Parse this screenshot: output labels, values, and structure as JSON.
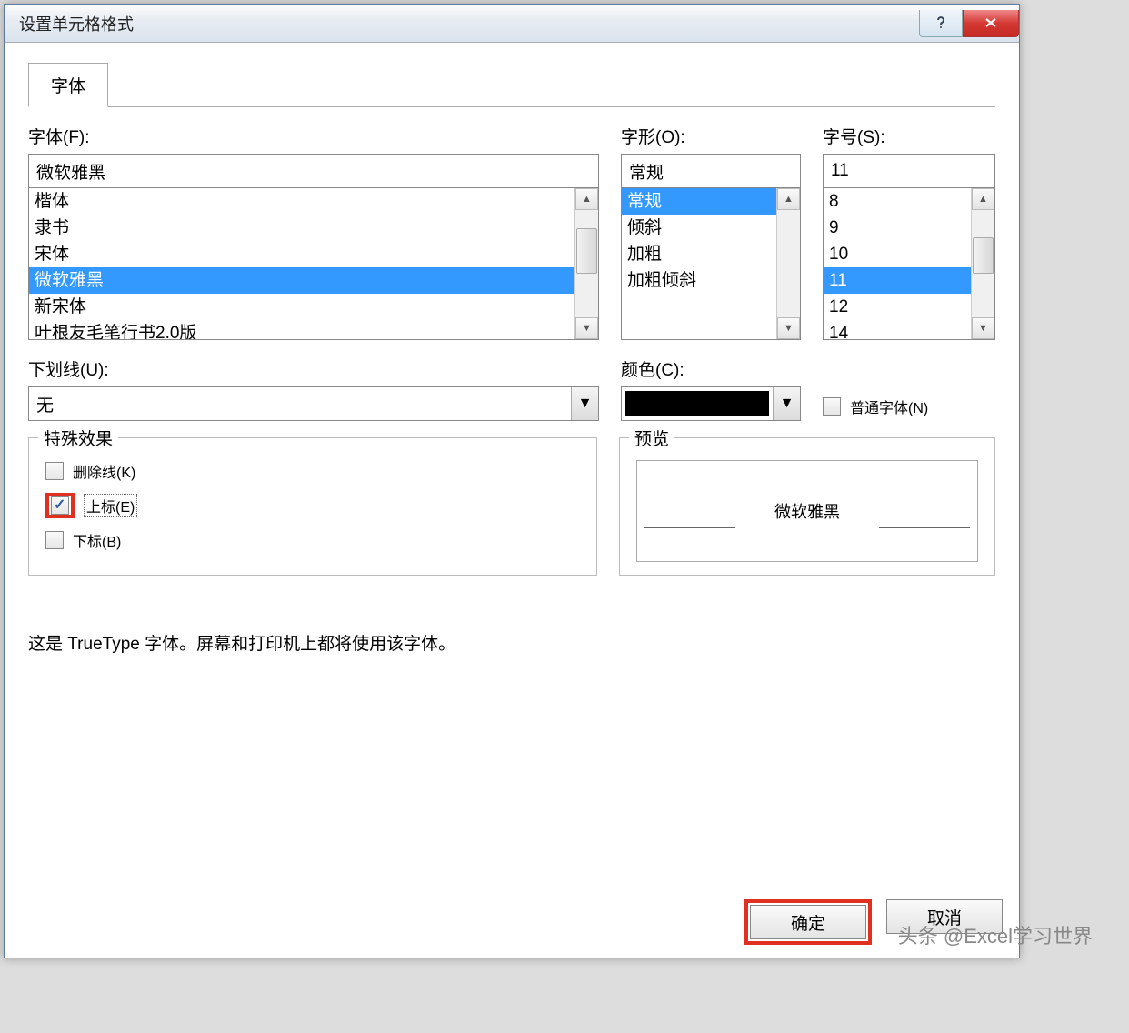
{
  "dialog": {
    "title": "设置单元格格式",
    "tab": "字体"
  },
  "font": {
    "label": "字体(F):",
    "value": "微软雅黑",
    "items": [
      "楷体",
      "隶书",
      "宋体",
      "微软雅黑",
      "新宋体",
      "叶根友毛笔行书2.0版"
    ],
    "selected_index": 3
  },
  "style": {
    "label": "字形(O):",
    "value": "常规",
    "items": [
      "常规",
      "倾斜",
      "加粗",
      "加粗倾斜"
    ],
    "selected_index": 0
  },
  "size": {
    "label": "字号(S):",
    "value": "11",
    "items": [
      "8",
      "9",
      "10",
      "11",
      "12",
      "14"
    ],
    "selected_index": 3
  },
  "underline": {
    "label": "下划线(U):",
    "value": "无"
  },
  "color": {
    "label": "颜色(C):",
    "value": "#000000"
  },
  "normal_font": {
    "label": "普通字体(N)",
    "checked": false
  },
  "effects": {
    "legend": "特殊效果",
    "strikethrough": {
      "label": "删除线(K)",
      "checked": false
    },
    "superscript": {
      "label": "上标(E)",
      "checked": true
    },
    "subscript": {
      "label": "下标(B)",
      "checked": false
    }
  },
  "preview": {
    "legend": "预览",
    "sample": "微软雅黑"
  },
  "footnote": "这是 TrueType 字体。屏幕和打印机上都将使用该字体。",
  "buttons": {
    "ok": "确定",
    "cancel": "取消"
  },
  "watermark": "头条 @Excel学习世界"
}
